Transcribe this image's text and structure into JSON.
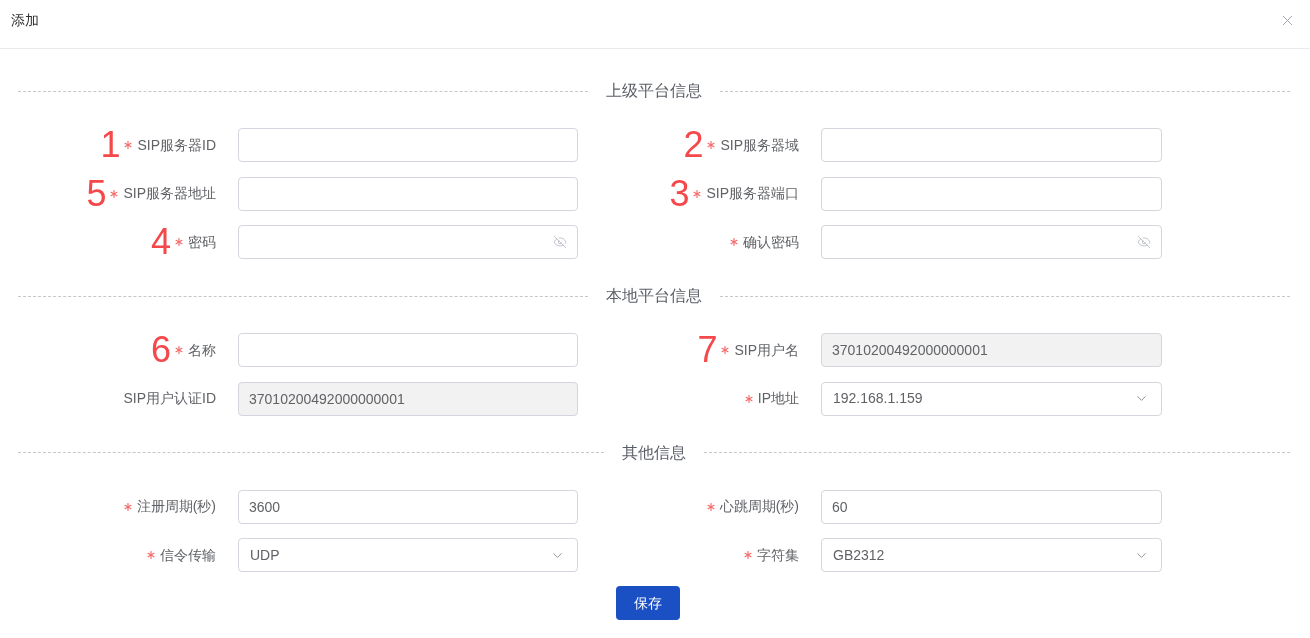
{
  "dialog": {
    "title": "添加"
  },
  "sections": [
    {
      "title": "上级平台信息",
      "fields": [
        {
          "kind": "text",
          "label": "SIP服务器ID",
          "required": true,
          "disabled": false,
          "annotation": "1"
        },
        {
          "kind": "text",
          "label": "SIP服务器域",
          "required": true,
          "disabled": false,
          "annotation": "2"
        },
        {
          "kind": "text",
          "label": "SIP服务器地址",
          "required": true,
          "disabled": false,
          "annotation": "5"
        },
        {
          "kind": "text",
          "label": "SIP服务器端口",
          "required": true,
          "disabled": false,
          "annotation": "3"
        },
        {
          "kind": "password",
          "label": "密码",
          "required": true,
          "disabled": false,
          "annotation": "4"
        },
        {
          "kind": "password",
          "label": "确认密码",
          "required": true,
          "disabled": false
        }
      ]
    },
    {
      "title": "本地平台信息",
      "fields": [
        {
          "kind": "text",
          "label": "名称",
          "required": true,
          "disabled": false,
          "annotation": "6"
        },
        {
          "kind": "text",
          "label": "SIP用户名",
          "required": true,
          "disabled": true,
          "annotation": "7",
          "value": "37010200492000000001"
        },
        {
          "kind": "text",
          "label": "SIP用户认证ID",
          "required": false,
          "disabled": true,
          "value": "37010200492000000001"
        },
        {
          "kind": "select",
          "label": "IP地址",
          "required": true,
          "disabled": false,
          "value": "192.168.1.159"
        }
      ]
    },
    {
      "title": "其他信息",
      "fields": [
        {
          "kind": "text",
          "label": "注册周期(秒)",
          "required": true,
          "disabled": false,
          "value": "3600"
        },
        {
          "kind": "text",
          "label": "心跳周期(秒)",
          "required": true,
          "disabled": false,
          "value": "60"
        },
        {
          "kind": "select",
          "label": "信令传输",
          "required": true,
          "disabled": false,
          "value": "UDP"
        },
        {
          "kind": "select",
          "label": "字符集",
          "required": true,
          "disabled": false,
          "value": "GB2312"
        }
      ]
    }
  ],
  "save_button": {
    "label": "保存"
  }
}
